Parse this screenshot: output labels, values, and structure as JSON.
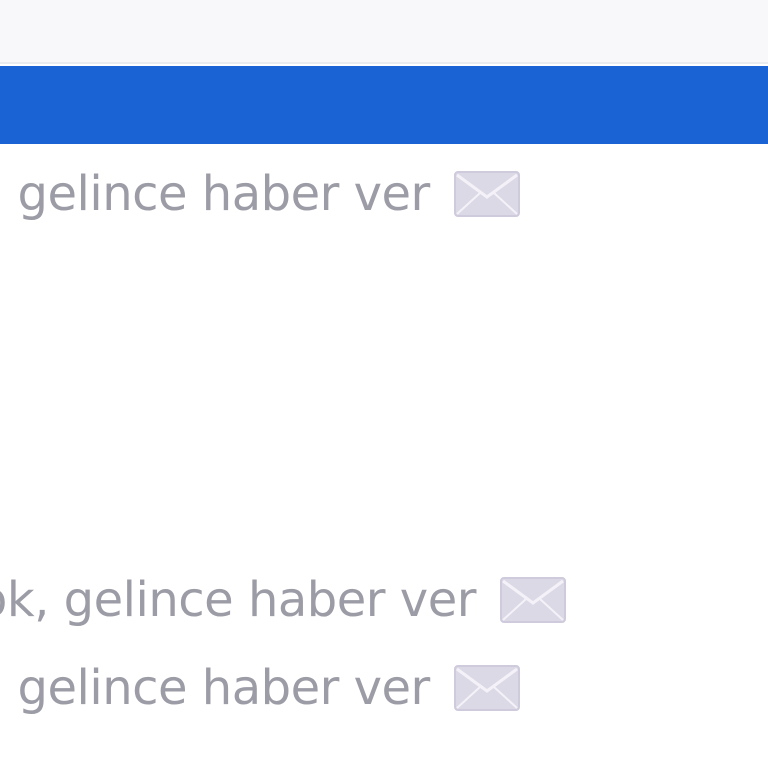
{
  "stock_notices": [
    {
      "text": ", gelince haber ver",
      "icon": "envelope-icon"
    },
    {
      "text": "ok, gelince haber ver",
      "icon": "envelope-icon"
    },
    {
      "text": ", gelince haber ver",
      "icon": "envelope-icon"
    }
  ],
  "colors": {
    "blue_bar": "#1a63d4",
    "text": "#9c9ca6",
    "envelope": "#dcd9e6"
  }
}
